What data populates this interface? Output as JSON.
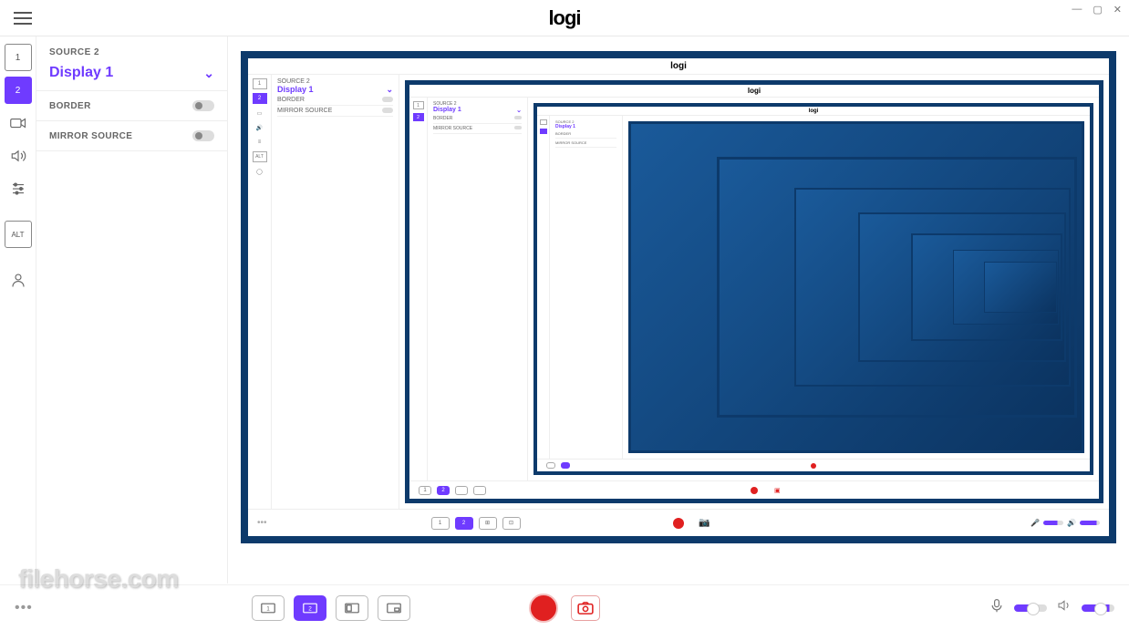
{
  "app": {
    "logo": "logi"
  },
  "window": {
    "min": "—",
    "max": "▢",
    "close": "✕"
  },
  "rail": {
    "source1": "1",
    "source2": "2",
    "alt": "ALT"
  },
  "panel": {
    "label": "SOURCE 2",
    "title": "Display 1",
    "border": "BORDER",
    "mirror": "MIRROR SOURCE"
  },
  "scenes": {
    "s1": "1",
    "s2": "2",
    "s3": "⊞",
    "s4": "⊡"
  },
  "watermark": "filehorse.com",
  "colors": {
    "accent": "#6f3bff",
    "record": "#e02020",
    "frame": "#0d3a6b"
  }
}
